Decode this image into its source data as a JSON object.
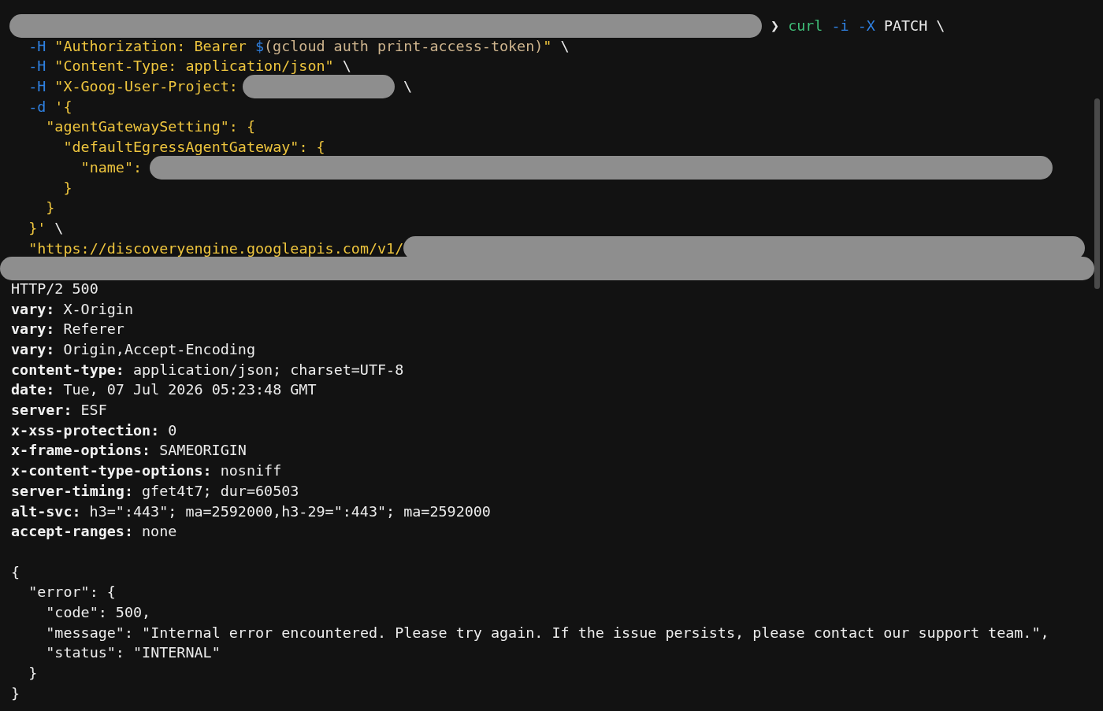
{
  "command_lines": [
    {
      "segments": [
        {
          "kind": "redaction"
        },
        {
          "kind": "prompt",
          "text": "❯"
        },
        {
          "kind": "cmd",
          "text": "curl"
        },
        {
          "kind": "flag",
          "text": "-i -X"
        },
        {
          "kind": "plain",
          "text": "PATCH \\"
        }
      ]
    },
    {
      "segments": [
        {
          "kind": "flag",
          "text": "  -H"
        },
        {
          "kind": "str",
          "text": "\"Authorization: Bearer"
        },
        {
          "kind": "dollar",
          "text": "$"
        },
        {
          "kind": "sub",
          "text": "(gcloud auth print-access-token)"
        },
        {
          "kind": "str",
          "text": "\""
        },
        {
          "kind": "plain",
          "text": "\\"
        }
      ]
    },
    {
      "segments": [
        {
          "kind": "flag",
          "text": "  -H"
        },
        {
          "kind": "str",
          "text": "\"Content-Type: application/json\""
        },
        {
          "kind": "plain",
          "text": "\\"
        }
      ]
    },
    {
      "segments": [
        {
          "kind": "flag",
          "text": "  -H"
        },
        {
          "kind": "str",
          "text": "\"X-Goog-User-Project:"
        },
        {
          "kind": "redaction"
        },
        {
          "kind": "plain",
          "text": "\\"
        }
      ]
    },
    {
      "segments": [
        {
          "kind": "flag",
          "text": "  -d"
        },
        {
          "kind": "str",
          "text": "'{"
        }
      ]
    },
    {
      "segments": [
        {
          "kind": "str",
          "text": "    \"agentGatewaySetting\": {"
        }
      ]
    },
    {
      "segments": [
        {
          "kind": "str",
          "text": "      \"defaultEgressAgentGateway\": {"
        }
      ]
    },
    {
      "segments": [
        {
          "kind": "str",
          "text": "        \"name\":"
        },
        {
          "kind": "redaction"
        }
      ]
    },
    {
      "segments": [
        {
          "kind": "str",
          "text": "      }"
        }
      ]
    },
    {
      "segments": [
        {
          "kind": "str",
          "text": "    }"
        }
      ]
    },
    {
      "segments": [
        {
          "kind": "str",
          "text": "  }'"
        },
        {
          "kind": "plain",
          "text": "\\"
        }
      ]
    },
    {
      "segments": [
        {
          "kind": "str",
          "text": "  \"https://discoveryengine.googleapis.com/v1/"
        },
        {
          "kind": "redaction"
        }
      ]
    },
    {
      "segments": [
        {
          "kind": "redaction"
        }
      ]
    }
  ],
  "status_line": "HTTP/2 500",
  "headers": [
    {
      "name": "vary:",
      "value": "X-Origin"
    },
    {
      "name": "vary:",
      "value": "Referer"
    },
    {
      "name": "vary:",
      "value": "Origin,Accept-Encoding"
    },
    {
      "name": "content-type:",
      "value": "application/json; charset=UTF-8"
    },
    {
      "name": "date:",
      "value": "Tue, 07 Jul 2026 05:23:48 GMT"
    },
    {
      "name": "server:",
      "value": "ESF"
    },
    {
      "name": "x-xss-protection:",
      "value": "0"
    },
    {
      "name": "x-frame-options:",
      "value": "SAMEORIGIN"
    },
    {
      "name": "x-content-type-options:",
      "value": "nosniff"
    },
    {
      "name": "server-timing:",
      "value": "gfet4t7; dur=60503"
    },
    {
      "name": "alt-svc:",
      "value": "h3=\":443\"; ma=2592000,h3-29=\":443\"; ma=2592000"
    },
    {
      "name": "accept-ranges:",
      "value": "none"
    }
  ],
  "body_lines": [
    "{",
    "  \"error\": {",
    "    \"code\": 500,",
    "    \"message\": \"Internal error encountered. Please try again. If the issue persists, please contact our support team.\",",
    "    \"status\": \"INTERNAL\"",
    "  }",
    "}"
  ]
}
